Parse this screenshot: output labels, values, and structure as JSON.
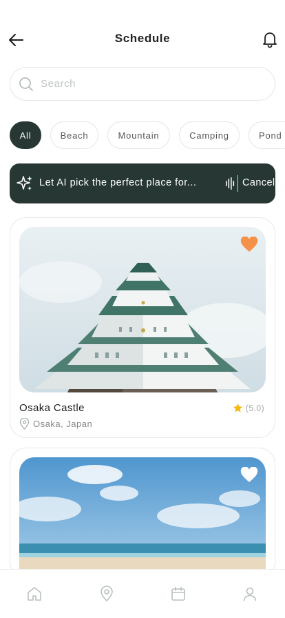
{
  "header": {
    "title": "Schedule",
    "back_icon": "arrow-left-icon",
    "bell_icon": "bell-icon"
  },
  "search": {
    "placeholder": "Search",
    "value": "",
    "icon": "search-icon"
  },
  "filters": [
    {
      "label": "All",
      "active": true
    },
    {
      "label": "Beach",
      "active": false
    },
    {
      "label": "Mountain",
      "active": false
    },
    {
      "label": "Camping",
      "active": false
    },
    {
      "label": "Pond",
      "active": false
    }
  ],
  "ai_banner": {
    "text": "Let AI pick the perfect place for...",
    "cancel_label": "Cancel",
    "icon": "sparkles-icon",
    "voice_icon": "voice-wave-icon"
  },
  "places": [
    {
      "name": "Osaka Castle",
      "location": "Osaka, Japan",
      "rating": "(5.0)",
      "favorite": true
    },
    {
      "name": "",
      "location": "",
      "rating": "",
      "favorite": false
    }
  ],
  "bottom_nav": [
    {
      "icon": "home-icon"
    },
    {
      "icon": "map-pin-icon"
    },
    {
      "icon": "calendar-icon"
    },
    {
      "icon": "user-icon"
    }
  ],
  "colors": {
    "primary": "#263734",
    "favorite": "#F4924A",
    "star": "#F6B90F"
  }
}
